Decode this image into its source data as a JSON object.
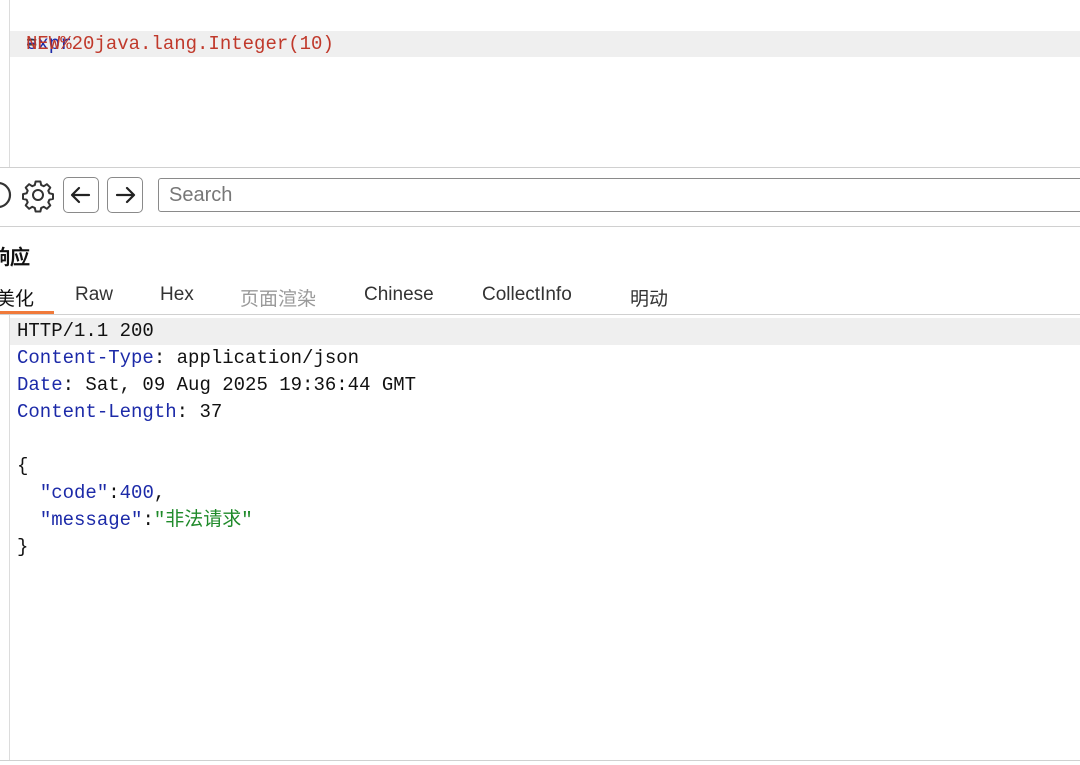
{
  "request": {
    "param_key": "expr",
    "param_sep": "=",
    "param_value": "NEW%20java.lang.Integer(10)"
  },
  "toolbar": {
    "icons": [
      "help-circle-icon",
      "gear-icon",
      "arrow-left-icon",
      "arrow-right-icon"
    ],
    "search_placeholder": "Search"
  },
  "response": {
    "title": "响应",
    "tabs": [
      {
        "label": "美化",
        "state": "active"
      },
      {
        "label": "Raw",
        "state": "normal"
      },
      {
        "label": "Hex",
        "state": "normal"
      },
      {
        "label": "页面渲染",
        "state": "disabled"
      },
      {
        "label": "Chinese",
        "state": "normal"
      },
      {
        "label": "CollectInfo",
        "state": "normal"
      },
      {
        "label": "明动",
        "state": "normal"
      }
    ],
    "status_line": "HTTP/1.1 200",
    "headers": [
      {
        "name": "Content-Type",
        "value": "application/json"
      },
      {
        "name": "Date",
        "value": "Sat, 09 Aug 2025 19:36:44 GMT"
      },
      {
        "name": "Content-Length",
        "value": "37"
      }
    ],
    "body": {
      "open_brace": "{",
      "code_key": "\"code\"",
      "code_value": "400",
      "message_key": "\"message\"",
      "message_value": "\"非法请求\"",
      "close_brace": "}"
    }
  },
  "colors": {
    "accent_underline": "#f07a3a",
    "key_blue": "#1c2aa8",
    "string_green": "#1f8a2a",
    "param_red": "#c0392b"
  }
}
